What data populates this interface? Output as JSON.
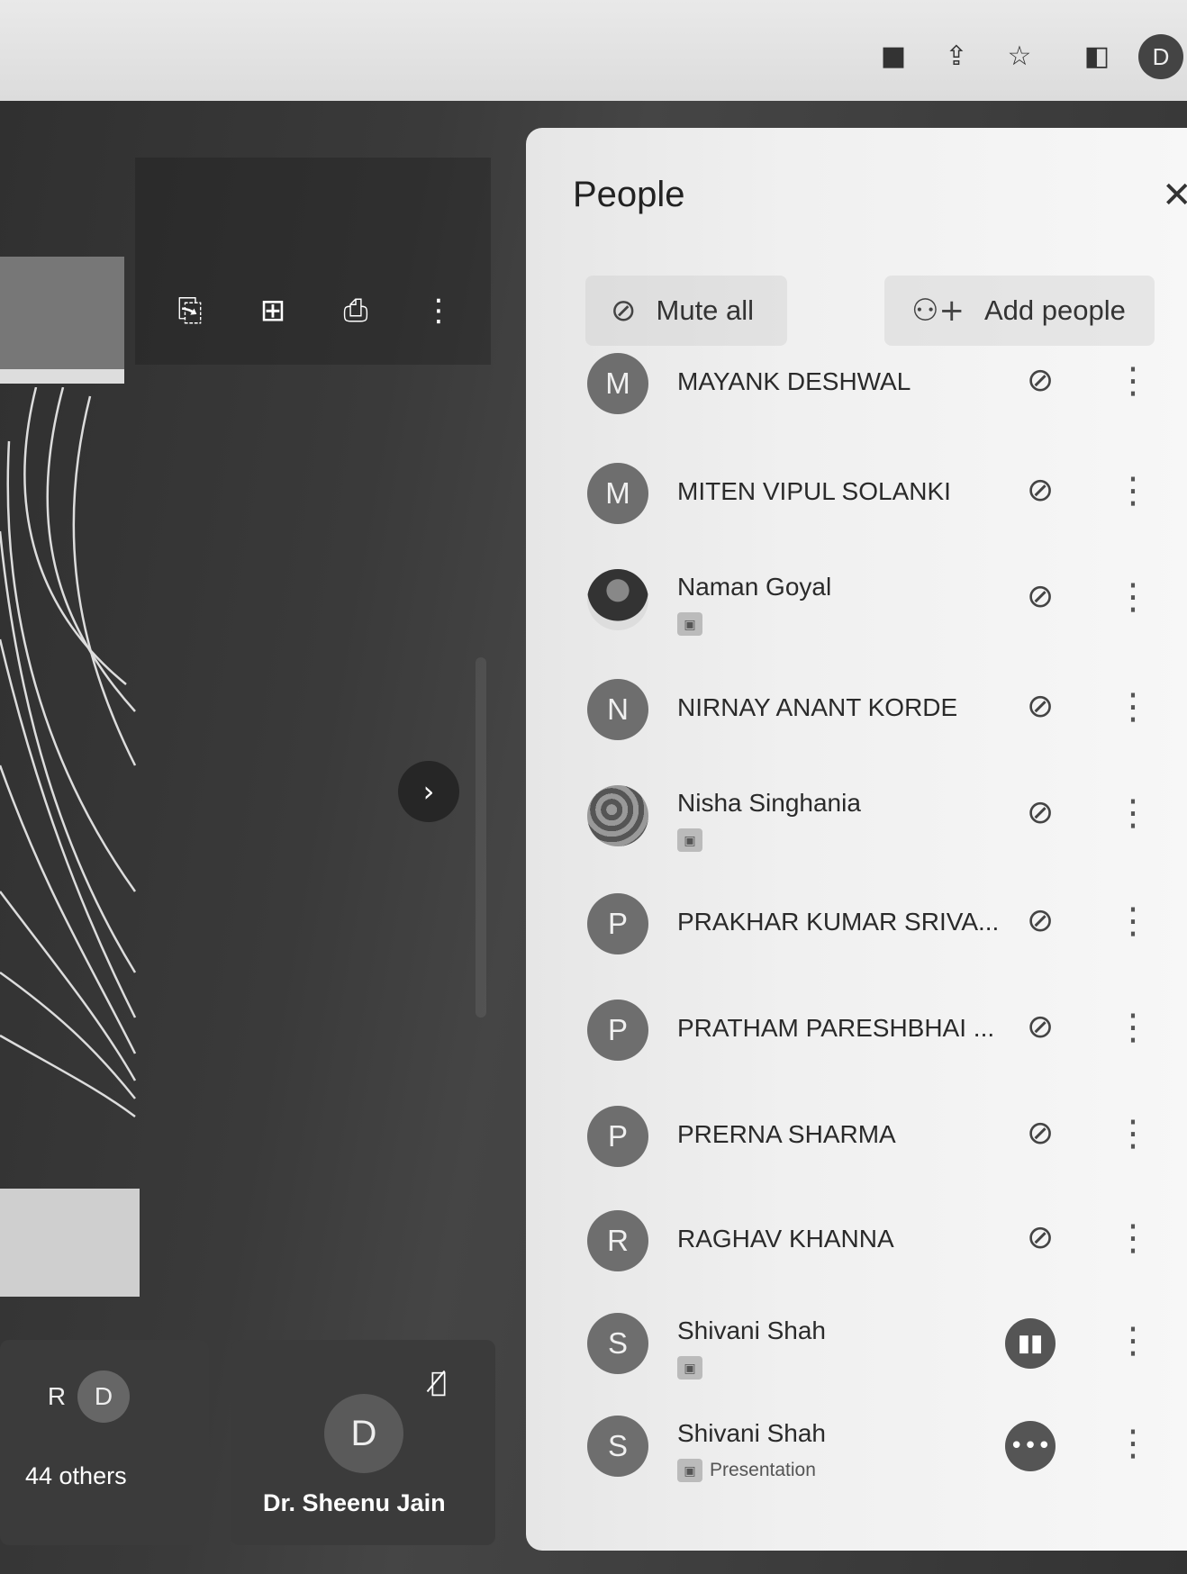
{
  "browser": {
    "icons": [
      "video-camera-icon",
      "share-icon",
      "star-icon",
      "sidebar-icon"
    ],
    "profile_initial": "D"
  },
  "presentation": {
    "toolbar": [
      "open-file-icon",
      "add-comment-icon",
      "print-icon",
      "more-vertical-icon"
    ],
    "next_icon": "chevron-right-icon"
  },
  "tiles": {
    "others": {
      "initials": [
        "R",
        "D"
      ],
      "label": "44 others"
    },
    "host": {
      "initial": "D",
      "label": "Dr. Sheenu Jain"
    }
  },
  "people_panel": {
    "title": "People",
    "mute_all_label": "Mute all",
    "add_people_label": "Add people",
    "participants": [
      {
        "name": "MAYANK DESHWAL",
        "initial": "M",
        "avatar": "letter",
        "status": "muted"
      },
      {
        "name": "MITEN VIPUL SOLANKI",
        "initial": "M",
        "avatar": "letter",
        "status": "muted"
      },
      {
        "name": "Naman Goyal",
        "initial": "",
        "avatar": "photo",
        "status": "muted",
        "has_badge": true
      },
      {
        "name": "NIRNAY ANANT KORDE",
        "initial": "N",
        "avatar": "letter",
        "status": "muted"
      },
      {
        "name": "Nisha Singhania",
        "initial": "",
        "avatar": "spiral",
        "status": "muted",
        "has_badge": true
      },
      {
        "name": "PRAKHAR KUMAR SRIVA...",
        "initial": "P",
        "avatar": "letter",
        "status": "muted"
      },
      {
        "name": "PRATHAM PARESHBHAI ...",
        "initial": "P",
        "avatar": "letter",
        "status": "muted"
      },
      {
        "name": "PRERNA SHARMA",
        "initial": "P",
        "avatar": "letter",
        "status": "muted"
      },
      {
        "name": "RAGHAV KHANNA",
        "initial": "R",
        "avatar": "letter",
        "status": "muted"
      },
      {
        "name": "Shivani Shah",
        "initial": "S",
        "avatar": "letter",
        "status": "speaking",
        "has_badge": true
      },
      {
        "name": "Shivani Shah",
        "initial": "S",
        "avatar": "letter",
        "status": "presenting",
        "subtitle": "Presentation"
      }
    ]
  },
  "colors": {
    "panel_bg": "#f0f0f0",
    "stage_bg": "#3a3a3a",
    "avatar_bg": "#6e6e6e"
  }
}
